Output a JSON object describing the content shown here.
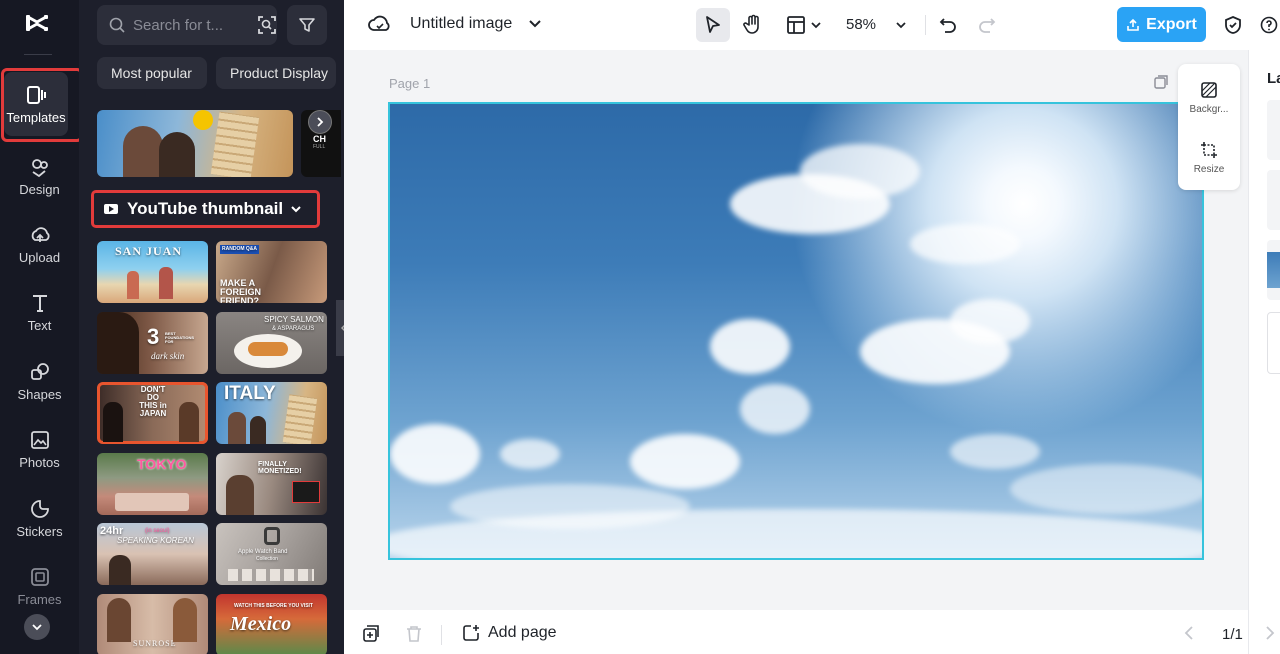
{
  "rail": {
    "items": [
      {
        "label": "Templates",
        "icon": "templates-icon"
      },
      {
        "label": "Design",
        "icon": "design-icon"
      },
      {
        "label": "Upload",
        "icon": "upload-icon"
      },
      {
        "label": "Text",
        "icon": "text-icon"
      },
      {
        "label": "Shapes",
        "icon": "shapes-icon"
      },
      {
        "label": "Photos",
        "icon": "photos-icon"
      },
      {
        "label": "Stickers",
        "icon": "stickers-icon"
      },
      {
        "label": "Frames",
        "icon": "frames-icon"
      }
    ]
  },
  "panel": {
    "search_placeholder": "Search for t...",
    "chips": [
      "Most popular",
      "Product Display"
    ],
    "featured_partial_text": "CH",
    "featured_partial_small": "FULL",
    "section_title": "YouTube thumbnail",
    "thumbnails": [
      {
        "text": "SAN JUAN"
      },
      {
        "text": "MAKE A FOREIGN FRIEND?",
        "badge": "RANDOM Q&A"
      },
      {
        "text": "3",
        "sub": "BEST FOUNDATIONS FOR",
        "script": "dark skin"
      },
      {
        "text": "SPICY SALMON",
        "sub": "& ASPARAGUS"
      },
      {
        "text": "DON'T DO THIS in JAPAN"
      },
      {
        "text": "ITALY"
      },
      {
        "text": "TOKYO"
      },
      {
        "text": "FINALLY MONETIZED!"
      },
      {
        "text": "24hr",
        "sub": "(in seoul)",
        "script": "SPEAKING KOREAN"
      },
      {
        "text": "Apple Watch Band",
        "sub": "Collection"
      },
      {
        "text": "SUNROSE"
      },
      {
        "text": "Mexico",
        "sub": "WATCH THIS BEFORE YOU VISIT"
      }
    ]
  },
  "topbar": {
    "title": "Untitled image",
    "zoom": "58%",
    "export_label": "Export"
  },
  "canvas": {
    "page_label": "Page 1",
    "side_tools": [
      "Backgr...",
      "Resize"
    ]
  },
  "right": {
    "title_partial": "La"
  },
  "bottombar": {
    "add_page_label": "Add page",
    "pager": "1/1"
  },
  "colors": {
    "accent": "#2aa3f5",
    "highlight": "#e23b3b",
    "canvas_border": "#36c3dc",
    "sidebar_bg": "#161823",
    "panel_bg": "#1d1f2b"
  }
}
